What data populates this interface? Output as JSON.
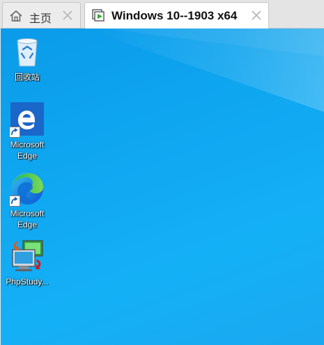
{
  "tabs": [
    {
      "label": "主页",
      "icon": "home-icon",
      "active": false
    },
    {
      "label": "Windows 10--1903 x64",
      "icon": "vm-play-icon",
      "active": true
    }
  ],
  "desktop": {
    "background": "#0fa6f0",
    "icons": [
      {
        "label": "回收站",
        "icon": "recycle-bin-icon"
      },
      {
        "label": "Microsoft Edge",
        "icon": "edge-legacy-icon"
      },
      {
        "label": "Microsoft Edge",
        "icon": "edge-chromium-icon"
      },
      {
        "label": "PhpStudy...",
        "icon": "phpstudy-icon"
      }
    ]
  }
}
